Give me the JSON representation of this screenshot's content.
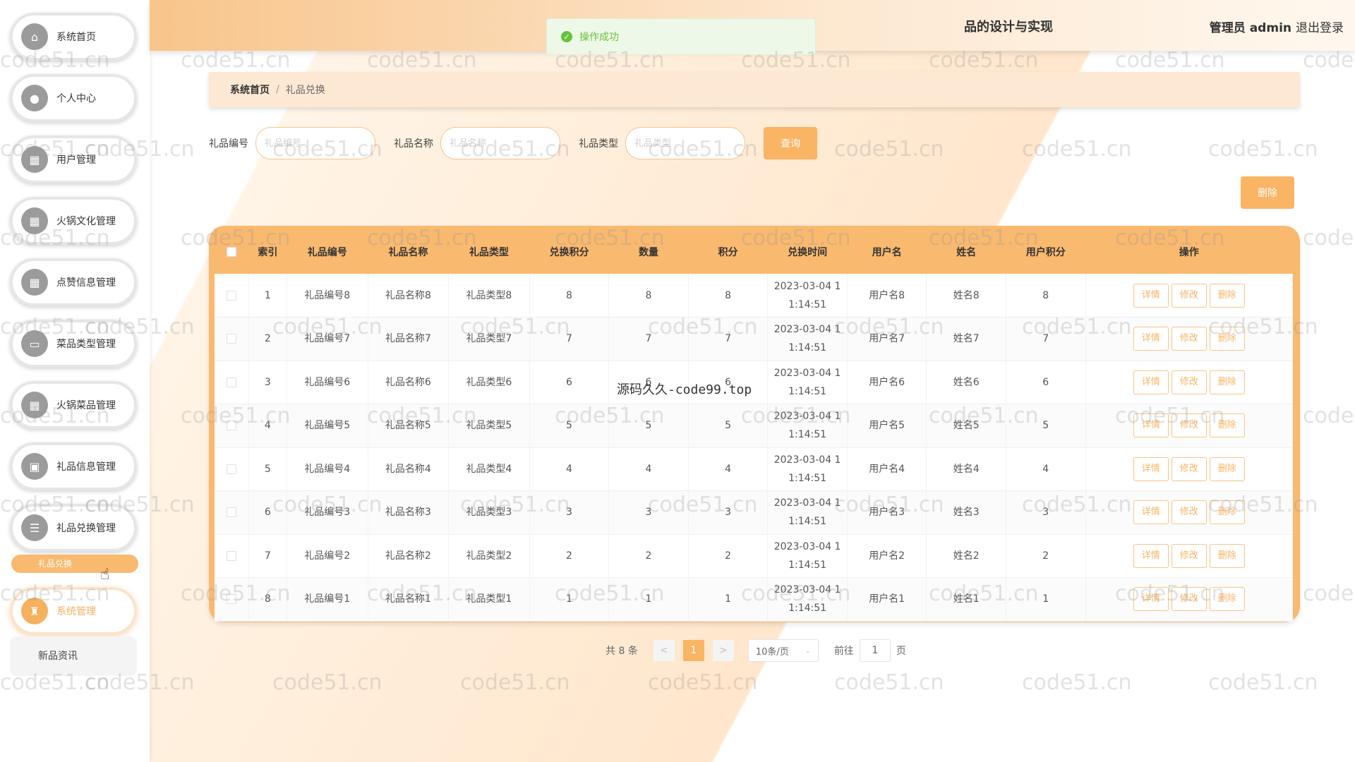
{
  "header": {
    "title": "品的设计与实现",
    "admin_label": "管理员 admin",
    "logout": "退出登录"
  },
  "toast": {
    "message": "操作成功"
  },
  "sidebar": {
    "items": [
      {
        "label": "系统首页",
        "icon": "home-icon",
        "glyph": "⌂"
      },
      {
        "label": "个人中心",
        "icon": "user-icon",
        "glyph": "●"
      },
      {
        "label": "用户管理",
        "icon": "grid-icon",
        "glyph": "▦"
      },
      {
        "label": "火锅文化管理",
        "icon": "grid-icon",
        "glyph": "▦"
      },
      {
        "label": "点赞信息管理",
        "icon": "grid-icon",
        "glyph": "▦"
      },
      {
        "label": "菜品类型管理",
        "icon": "doc-icon",
        "glyph": "▭"
      },
      {
        "label": "火锅菜品管理",
        "icon": "grid-icon",
        "glyph": "▦"
      },
      {
        "label": "礼品信息管理",
        "icon": "bag-icon",
        "glyph": "▣"
      },
      {
        "label": "礼品兑换管理",
        "icon": "list-icon",
        "glyph": "☰"
      }
    ],
    "sub_item": "礼品兑换",
    "active_item": {
      "label": "系统管理",
      "icon": "trophy-icon",
      "glyph": "♜"
    },
    "plain_item": "新品资讯"
  },
  "breadcrumb": {
    "home": "系统首页",
    "separator": "/",
    "current": "礼品兑换"
  },
  "search": {
    "fields": [
      {
        "label": "礼品编号",
        "placeholder": "礼品编号"
      },
      {
        "label": "礼品名称",
        "placeholder": "礼品名称"
      },
      {
        "label": "礼品类型",
        "placeholder": "礼品类型"
      }
    ],
    "query_button": "查询",
    "delete_button": "删除"
  },
  "table": {
    "columns": [
      "索引",
      "礼品编号",
      "礼品名称",
      "礼品类型",
      "兑换积分",
      "数量",
      "积分",
      "兑换时间",
      "用户名",
      "姓名",
      "用户积分",
      "操作"
    ],
    "actions": [
      "详情",
      "修改",
      "删除"
    ],
    "rows": [
      [
        "1",
        "礼品编号8",
        "礼品名称8",
        "礼品类型8",
        "8",
        "8",
        "8",
        "2023-03-04 1",
        "1:14:51",
        "用户名8",
        "姓名8",
        "8"
      ],
      [
        "2",
        "礼品编号7",
        "礼品名称7",
        "礼品类型7",
        "7",
        "7",
        "7",
        "2023-03-04 1",
        "1:14:51",
        "用户名7",
        "姓名7",
        "7"
      ],
      [
        "3",
        "礼品编号6",
        "礼品名称6",
        "礼品类型6",
        "6",
        "6",
        "6",
        "2023-03-04 1",
        "1:14:51",
        "用户名6",
        "姓名6",
        "6"
      ],
      [
        "4",
        "礼品编号5",
        "礼品名称5",
        "礼品类型5",
        "5",
        "5",
        "5",
        "2023-03-04 1",
        "1:14:51",
        "用户名5",
        "姓名5",
        "5"
      ],
      [
        "5",
        "礼品编号4",
        "礼品名称4",
        "礼品类型4",
        "4",
        "4",
        "4",
        "2023-03-04 1",
        "1:14:51",
        "用户名4",
        "姓名4",
        "4"
      ],
      [
        "6",
        "礼品编号3",
        "礼品名称3",
        "礼品类型3",
        "3",
        "3",
        "3",
        "2023-03-04 1",
        "1:14:51",
        "用户名3",
        "姓名3",
        "3"
      ],
      [
        "7",
        "礼品编号2",
        "礼品名称2",
        "礼品类型2",
        "2",
        "2",
        "2",
        "2023-03-04 1",
        "1:14:51",
        "用户名2",
        "姓名2",
        "2"
      ],
      [
        "8",
        "礼品编号1",
        "礼品名称1",
        "礼品类型1",
        "1",
        "1",
        "1",
        "2023-03-04 1",
        "1:14:51",
        "用户名1",
        "姓名1",
        "1"
      ]
    ]
  },
  "pagination": {
    "total": "共 8 条",
    "prev": "<",
    "current_page": "1",
    "next": ">",
    "page_size": "10条/页",
    "goto_label": "前往",
    "goto_value": "1",
    "page_suffix": "页"
  },
  "overlay": {
    "watermark": "code51.cn",
    "center_text": "源码久久-code99.top"
  },
  "colors": {
    "accent": "#f9b464",
    "success": "#67c23a"
  }
}
